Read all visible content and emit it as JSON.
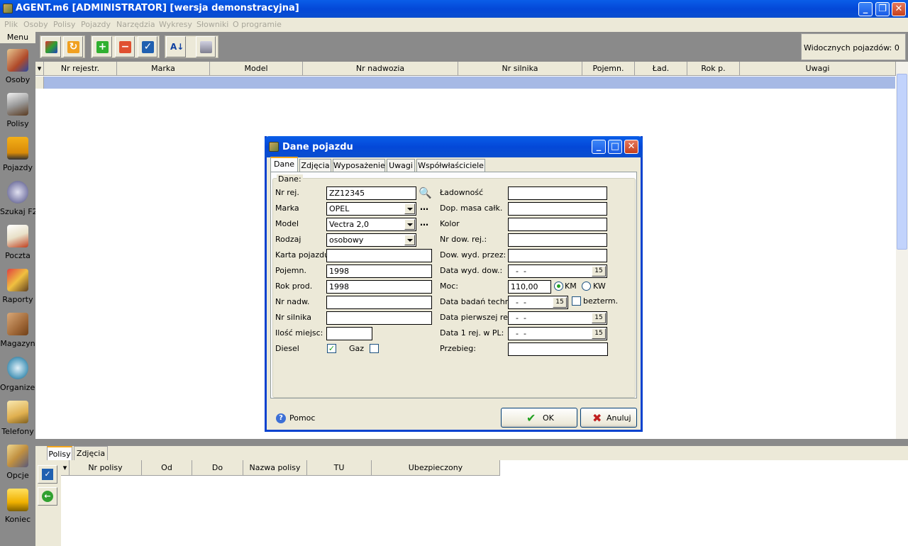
{
  "window": {
    "title": "AGENT.m6 [ADMINISTRATOR] [wersja demonstracyjna]"
  },
  "menu": [
    "Plik",
    "Osoby",
    "Polisy",
    "Pojazdy",
    "Narzędzia",
    "Wykresy",
    "Słowniki",
    "O programie"
  ],
  "sidebar": {
    "header": "Menu",
    "items": [
      {
        "label": "Osoby",
        "icon": "people-icon"
      },
      {
        "label": "Polisy",
        "icon": "policies-icon"
      },
      {
        "label": "Pojazdy",
        "icon": "truck-icon"
      },
      {
        "label": "Szukaj F2",
        "icon": "search-icon"
      },
      {
        "label": "Poczta",
        "icon": "mail-icon"
      },
      {
        "label": "Raporty",
        "icon": "pencil-icon"
      },
      {
        "label": "Magazyn",
        "icon": "box-icon"
      },
      {
        "label": "Organizer",
        "icon": "clock-icon"
      },
      {
        "label": "Telefony",
        "icon": "phone-icon"
      },
      {
        "label": "Opcje",
        "icon": "hammer-icon"
      },
      {
        "label": "Koniec",
        "icon": "exit-icon"
      }
    ]
  },
  "status": {
    "visible_vehicles": "Widocznych pojazdów: 0"
  },
  "grid": {
    "columns": [
      "Nr rejestr.",
      "Marka",
      "Model",
      "Nr nadwozia",
      "Nr silnika",
      "Pojemn.",
      "Ład.",
      "Rok p.",
      "Uwagi"
    ]
  },
  "bottom": {
    "tabs": [
      "Polisy",
      "Zdjęcia"
    ],
    "columns": [
      "Nr polisy",
      "Od",
      "Do",
      "Nazwa polisy",
      "TU",
      "Ubezpieczony"
    ]
  },
  "dialog": {
    "title": "Dane pojazdu",
    "tabs": [
      "Dane",
      "Zdjęcia",
      "Wyposażenie",
      "Uwagi",
      "Współwłaściciele"
    ],
    "group_label": "Dane:",
    "left": {
      "nr_rej": {
        "label": "Nr rej.",
        "value": "ZZ12345"
      },
      "marka": {
        "label": "Marka",
        "value": "OPEL"
      },
      "model": {
        "label": "Model",
        "value": "Vectra 2,0"
      },
      "rodzaj": {
        "label": "Rodzaj",
        "value": "osobowy"
      },
      "karta": {
        "label": "Karta pojazdu:",
        "value": ""
      },
      "pojemn": {
        "label": "Pojemn.",
        "value": "1998"
      },
      "rok": {
        "label": "Rok prod.",
        "value": "1998"
      },
      "nr_nadw": {
        "label": "Nr nadw.",
        "value": ""
      },
      "nr_silnika": {
        "label": "Nr silnika",
        "value": ""
      },
      "miejsc": {
        "label": "Ilość miejsc:",
        "value": ""
      },
      "diesel": {
        "label": "Diesel",
        "checked": true
      },
      "gaz": {
        "label": "Gaz",
        "checked": false
      }
    },
    "right": {
      "ladownosc": {
        "label": "Ładowność",
        "value": ""
      },
      "dop_masa": {
        "label": "Dop. masa całk.",
        "value": ""
      },
      "kolor": {
        "label": "Kolor",
        "value": ""
      },
      "nr_dow": {
        "label": "Nr dow. rej.:",
        "value": ""
      },
      "dow_wyd": {
        "label": "Dow. wyd. przez:",
        "value": ""
      },
      "data_wyd": {
        "label": "Data wyd. dow.:",
        "value": "  -  -"
      },
      "moc": {
        "label": "Moc:",
        "value": "110,00",
        "unit_km": "KM",
        "unit_kw": "KW"
      },
      "data_badan": {
        "label": "Data badań techn.:",
        "value": "  -  -",
        "bezterm": "bezterm."
      },
      "data_pierwszej": {
        "label": "Data pierwszej rej.:",
        "value": "  -  -"
      },
      "data_pl": {
        "label": "Data 1 rej. w PL:",
        "value": "  -  -"
      },
      "przebieg": {
        "label": "Przebieg:",
        "value": ""
      }
    },
    "help": "Pomoc",
    "ok": "OK",
    "cancel": "Anuluj",
    "calendar_glyph": "15"
  }
}
